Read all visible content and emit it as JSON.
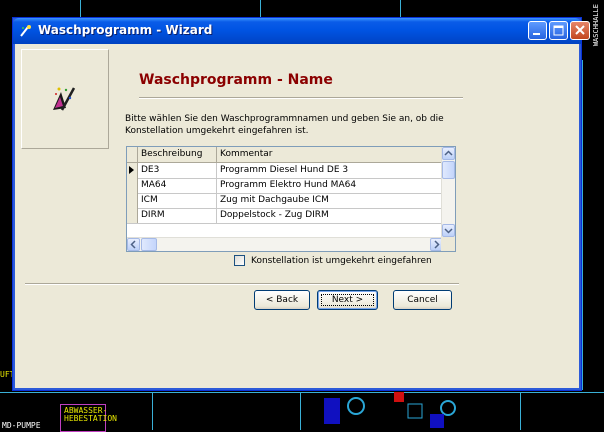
{
  "window": {
    "title": "Waschprogramm - Wizard",
    "title_icon": "wizard-app-icon",
    "controls": [
      "minimize",
      "maximize",
      "close"
    ]
  },
  "wizard": {
    "logo_icon": "magic-wand-icon",
    "heading": "Waschprogramm - Name",
    "instruction": "Bitte wählen Sie den Waschprogrammnamen und geben Sie an, ob die Konstellation umgekehrt eingefahren ist.",
    "grid": {
      "columns": [
        "Beschreibung",
        "Kommentar"
      ],
      "rows": [
        {
          "beschreibung": "DE3",
          "kommentar": "Programm Diesel Hund DE 3",
          "current": true
        },
        {
          "beschreibung": "MA64",
          "kommentar": "Programm Elektro Hund MA64",
          "current": false
        },
        {
          "beschreibung": "ICM",
          "kommentar": "Zug mit Dachgaube ICM",
          "current": false
        },
        {
          "beschreibung": "DIRM",
          "kommentar": "Doppelstock - Zug DIRM",
          "current": false
        }
      ]
    },
    "checkbox": {
      "label": "Konstellation ist umgekehrt eingefahren",
      "checked": false
    },
    "buttons": {
      "back": "< Back",
      "next": "Next >",
      "cancel": "Cancel"
    }
  },
  "background": {
    "labels": [
      "ABWASSER-",
      "HEBESTATION",
      "MD-PUMPE",
      "WASCHHALLE",
      "UFT"
    ]
  }
}
